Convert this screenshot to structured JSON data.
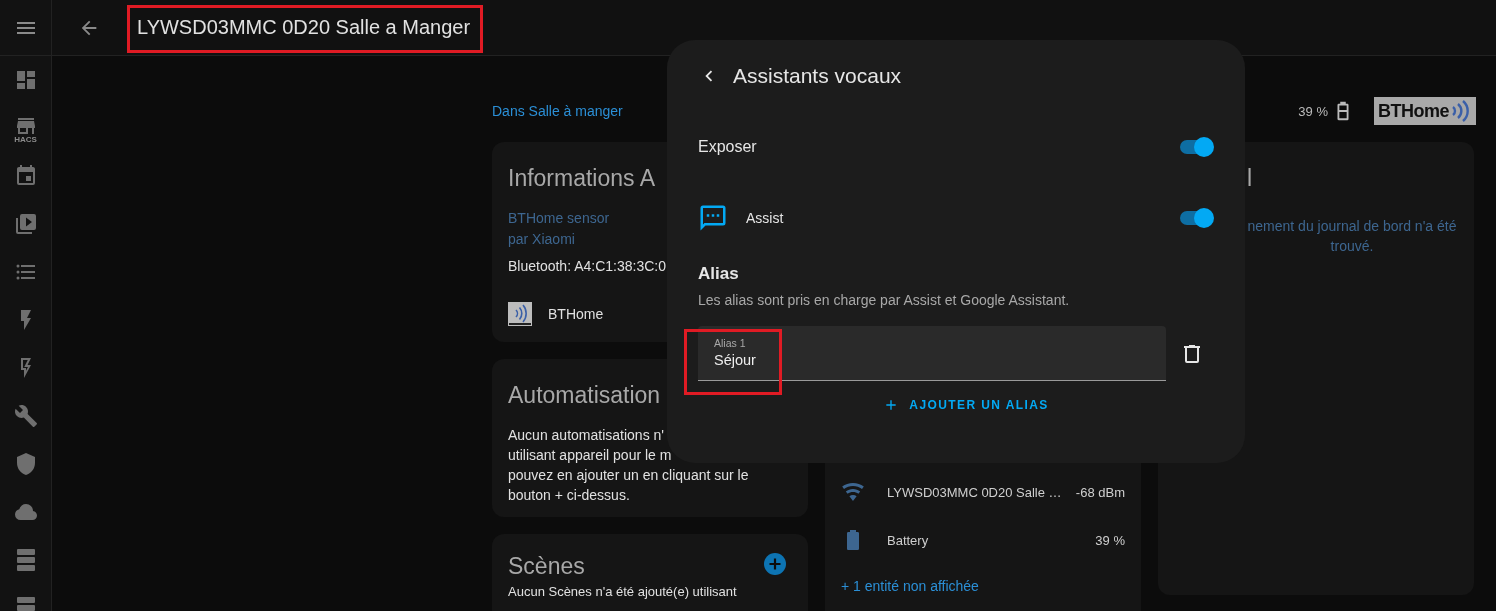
{
  "sidebar": {
    "store_label": "HACS"
  },
  "top_bar": {
    "title": "LYWSD03MMC 0D20 Salle a Manger"
  },
  "header": {
    "breadcrumb": "Dans Salle à manger",
    "battery_reading": "39 %",
    "logo_text": "BTHome"
  },
  "device_info": {
    "title": "Informations A",
    "model": "BTHome sensor",
    "manufacturer": "par Xiaomi",
    "connection": "Bluetooth: A4:C1:38:3C:0",
    "integration": "BTHome"
  },
  "automations": {
    "title": "Automatisation",
    "text": "Aucun automatisations n'\nutilisant appareil pour le m\npouvez en ajouter un en cliquant sur le\nbouton + ci-dessus."
  },
  "scenes": {
    "title": "Scènes",
    "text": "Aucun Scènes n'a été ajouté(e) utilisant"
  },
  "entities": {
    "rows": [
      {
        "kind": "signal",
        "name": "LYWSD03MMC 0D20 Salle …",
        "value": "-68 dBm"
      },
      {
        "kind": "battery",
        "name": "Battery",
        "value": "39 %"
      }
    ],
    "more_link": "+ 1 entité non affichée"
  },
  "logbook": {
    "title": "l",
    "text": "nement du journal de bord n'a été\ntrouvé."
  },
  "dialog": {
    "title": "Assistants vocaux",
    "expose": {
      "label": "Exposer",
      "on": true
    },
    "assistants": [
      {
        "name": "Assist",
        "on": true
      }
    ],
    "alias_heading": "Alias",
    "alias_help": "Les alias sont pris en charge par Assist et Google Assistant.",
    "aliases": [
      {
        "label": "Alias 1",
        "value": "Séjour"
      }
    ],
    "add_button": "AJOUTER UN ALIAS"
  }
}
